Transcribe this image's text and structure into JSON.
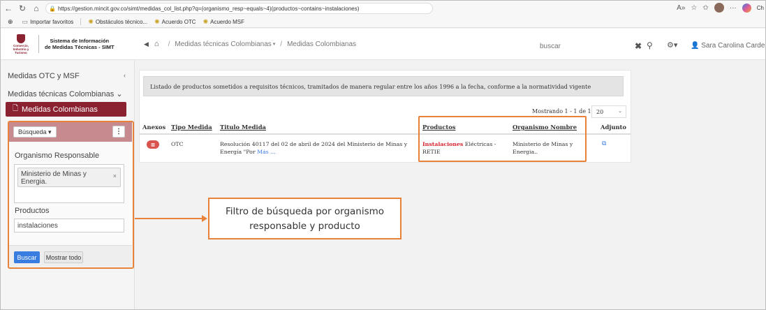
{
  "browser": {
    "url": "https://gestion.mincit.gov.co/simt/medidas_col_list.php?q=(organismo_resp~equals~4)(productos~contains~instalaciones)",
    "profile_label": "Ch",
    "bookmarks": [
      {
        "label": "Importar favoritos"
      },
      {
        "label": "Obstáculos técnico..."
      },
      {
        "label": "Acuerdo OTC"
      },
      {
        "label": "Acuerdo MSF"
      }
    ]
  },
  "header": {
    "crest_text": "Comercio, Industria y Turismo",
    "system_title_line1": "Sistema de Información",
    "system_title_line2": "de Medidas Técnicas - SIMT",
    "breadcrumb": {
      "item1": "Medidas técnicas Colombianas",
      "item2": "Medidas Colombianas"
    },
    "search_placeholder": "buscar",
    "user_name": "Sara Carolina Cardenas"
  },
  "sidebar": {
    "items": [
      {
        "label": "Medidas OTC y MSF"
      },
      {
        "label": "Medidas técnicas Colombianas"
      }
    ],
    "active_label": "Medidas Colombianas"
  },
  "filter": {
    "mode_button": "Búsqueda",
    "organismo_label": "Organismo Responsable",
    "organismo_value": "Ministerio de Minas y Energia.",
    "productos_label": "Productos",
    "productos_value": "instalaciones",
    "buscar_button": "Buscar",
    "mostrar_button": "Mostrar todo"
  },
  "listing": {
    "notice": "Listado de productos sometidos a requisitos técnicos, tramitados de manera regular entre los años 1996 a la fecha, conforme a la normatividad vigente",
    "pager_text": "Mostrando 1 - 1 de 1",
    "page_size": "20",
    "columns": {
      "anexos": "Anexos",
      "tipo": "Tipo Medida",
      "titulo": "Titulo Medida",
      "productos": "Productos",
      "organismo": "Organismo Nombre",
      "adjunto": "Adjunto"
    },
    "row": {
      "tipo": "OTC",
      "titulo_line1": "Resolución 40117 del 02 de abril de 2024 del Ministerio de Minas y",
      "titulo_line2": "Energía \"Por",
      "mas": "Más ...",
      "productos_highlight": "Instalaciones",
      "productos_rest1": " Eléctricas -",
      "productos_rest2": "RETIE",
      "organismo_line1": "Ministerio de Minas y",
      "organismo_line2": "Energia.."
    }
  },
  "annotation": {
    "line1": "Filtro de búsqueda por organismo",
    "line2": "responsable y producto"
  }
}
